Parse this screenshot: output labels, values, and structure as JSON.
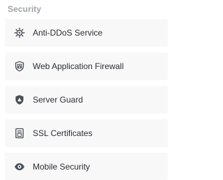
{
  "section": {
    "title": "Security"
  },
  "menu": {
    "items": [
      {
        "label": "Anti-DDoS Service",
        "icon": "gear-virus-icon"
      },
      {
        "label": "Web Application Firewall",
        "icon": "firewall-shield-icon"
      },
      {
        "label": "Server Guard",
        "icon": "server-guard-shield-icon"
      },
      {
        "label": "SSL Certificates",
        "icon": "certificate-icon"
      },
      {
        "label": "Mobile Security",
        "icon": "eye-icon"
      }
    ]
  },
  "colors": {
    "section_title": "#9ea3a8",
    "item_background": "#f8f8f9",
    "item_text": "#2b2f33",
    "icon": "#4a4f55"
  }
}
